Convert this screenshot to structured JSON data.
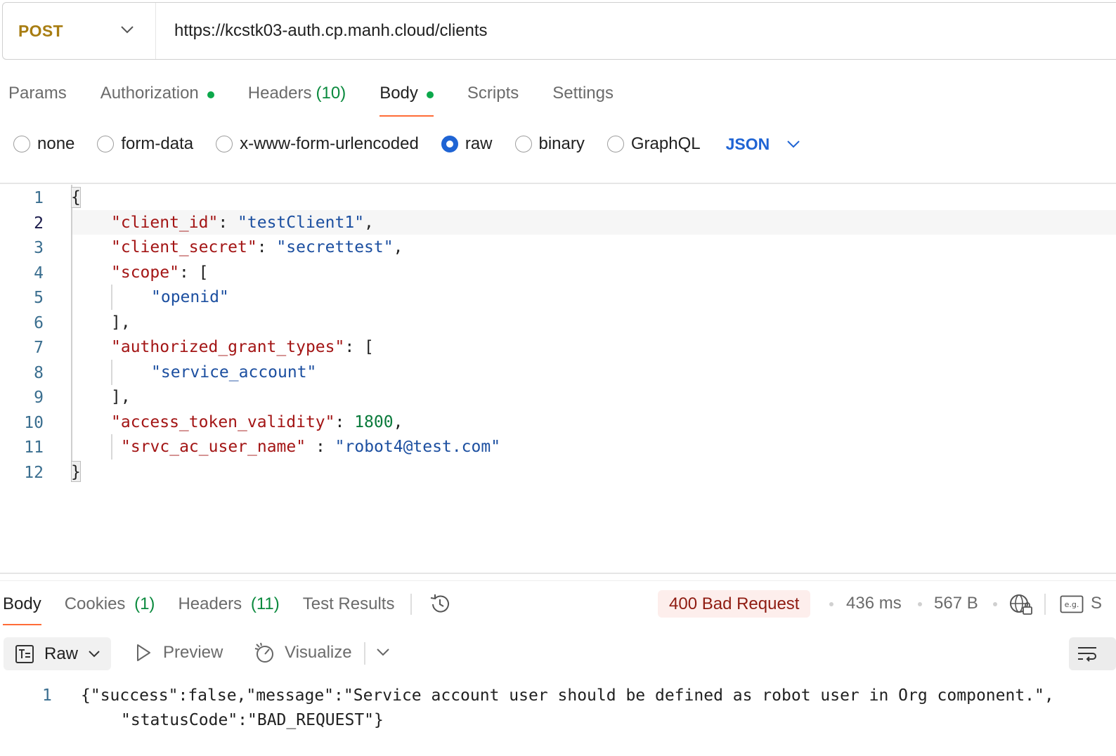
{
  "request": {
    "method": "POST",
    "url": "https://kcstk03-auth.cp.manh.cloud/clients"
  },
  "request_tabs": [
    {
      "label": "Params"
    },
    {
      "label": "Authorization",
      "dot": true
    },
    {
      "label": "Headers",
      "count": "(10)"
    },
    {
      "label": "Body",
      "dot": true,
      "active": true
    },
    {
      "label": "Scripts"
    },
    {
      "label": "Settings"
    }
  ],
  "body_types": {
    "options": [
      "none",
      "form-data",
      "x-www-form-urlencoded",
      "raw",
      "binary",
      "GraphQL"
    ],
    "selected": "raw",
    "format": "JSON"
  },
  "editor": {
    "line_numbers": [
      "1",
      "2",
      "3",
      "4",
      "5",
      "6",
      "7",
      "8",
      "9",
      "10",
      "11",
      "12"
    ],
    "lines": [
      [
        {
          "t": "punc",
          "v": "{"
        }
      ],
      [
        {
          "t": "key",
          "v": "\"client_id\""
        },
        {
          "t": "punc",
          "v": ": "
        },
        {
          "t": "str",
          "v": "\"testClient1\""
        },
        {
          "t": "punc",
          "v": ","
        }
      ],
      [
        {
          "t": "key",
          "v": "\"client_secret\""
        },
        {
          "t": "punc",
          "v": ": "
        },
        {
          "t": "str",
          "v": "\"secrettest\""
        },
        {
          "t": "punc",
          "v": ","
        }
      ],
      [
        {
          "t": "key",
          "v": "\"scope\""
        },
        {
          "t": "punc",
          "v": ": ["
        }
      ],
      [
        {
          "t": "str",
          "v": "\"openid\""
        }
      ],
      [
        {
          "t": "punc",
          "v": "],"
        }
      ],
      [
        {
          "t": "key",
          "v": "\"authorized_grant_types\""
        },
        {
          "t": "punc",
          "v": ": ["
        }
      ],
      [
        {
          "t": "str",
          "v": "\"service_account\""
        }
      ],
      [
        {
          "t": "punc",
          "v": "],"
        }
      ],
      [
        {
          "t": "key",
          "v": "\"access_token_validity\""
        },
        {
          "t": "punc",
          "v": ": "
        },
        {
          "t": "num",
          "v": "1800"
        },
        {
          "t": "punc",
          "v": ","
        }
      ],
      [
        {
          "t": "key",
          "v": "\"srvc_ac_user_name\""
        },
        {
          "t": "punc",
          "v": " : "
        },
        {
          "t": "str",
          "v": "\"robot4@test.com\""
        }
      ],
      [
        {
          "t": "punc",
          "v": "}"
        }
      ]
    ]
  },
  "response_tabs": [
    {
      "label": "Body",
      "active": true
    },
    {
      "label": "Cookies",
      "count": "(1)"
    },
    {
      "label": "Headers",
      "count": "(11)"
    },
    {
      "label": "Test Results"
    }
  ],
  "response_meta": {
    "status": "400 Bad Request",
    "time": "436 ms",
    "size": "567 B",
    "truncated_label": "S"
  },
  "response_toolbar": {
    "raw_label": "Raw",
    "preview_label": "Preview",
    "visualize_label": "Visualize",
    "eg_label": "e.g."
  },
  "response_body": {
    "line_number": "1",
    "line1": "{\"success\":false,\"message\":\"Service account user should be defined as robot user in Org component.\",",
    "line2": "\"statusCode\":\"BAD_REQUEST\"}"
  },
  "colors": {
    "method": "#a87d12",
    "accent": "#ff6c37",
    "link_blue": "#1f64d4",
    "count_green": "#0b8a3e",
    "status_error_bg": "#fdeeec",
    "status_error_text": "#8f1c12"
  }
}
